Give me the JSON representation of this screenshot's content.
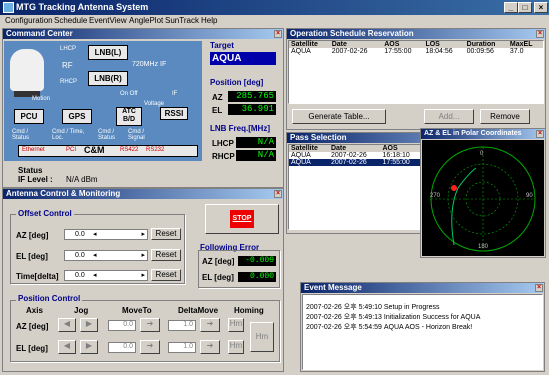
{
  "window": {
    "title": "MTG Tracking Antenna System",
    "min": "_",
    "max": "□",
    "close": "×"
  },
  "menu": [
    "Configuration",
    "Schedule",
    "EventView",
    "AnglePlot",
    "SunTrack",
    "Help"
  ],
  "command_center": {
    "title": "Command Center",
    "diagram": {
      "lhcp": "LHCP",
      "rhcp": "RHCP",
      "rf": "RF",
      "lnb_l": "LNB(L)",
      "lnb_r": "LNB(R)",
      "freq": "720MHz IF",
      "motion": "Motion",
      "pcu": "PCU",
      "gps": "GPS",
      "atc": "ATC B/D",
      "rssi": "RSSI",
      "onoff": "On Off",
      "voltage": "Voltage",
      "if": "IF",
      "cmd_status1": "Cmd / Status",
      "cmd_time": "Cmd / Time, Loc.",
      "cmd_status2": "Cmd / Status",
      "cmd_signal": "Cmd / Signal",
      "ethernet": "Ethernet",
      "pci": "PCI",
      "cm": "C&M",
      "rs422": "RS422",
      "rs232": "RS232"
    },
    "target_label": "Target",
    "target": "AQUA",
    "position_label": "Position [deg]",
    "az_label": "AZ",
    "az": "285.765",
    "el_label": "EL",
    "el": "36.991",
    "lnb_label": "LNB Freq.[MHz]",
    "lhcp_label": "LHCP",
    "lhcp": "N/A",
    "rhcp_label": "RHCP",
    "rhcp": "N/A",
    "status_label": "Status",
    "if_level_label": "IF Level :",
    "if_level": "N/A dBm"
  },
  "antenna": {
    "title": "Antenna Control & Monitoring",
    "offset_label": "Offset Control",
    "rows": [
      {
        "label": "AZ [deg]",
        "value": "0.0",
        "reset": "Reset"
      },
      {
        "label": "EL [deg]",
        "value": "0.0",
        "reset": "Reset"
      },
      {
        "label": "Time[delta]",
        "value": "0.0",
        "reset": "Reset"
      }
    ],
    "stop": "STOP",
    "following_label": "Following Error",
    "fe_az_label": "AZ [deg]",
    "fe_az": "-0.009",
    "fe_el_label": "EL [deg]",
    "fe_el": "0.000",
    "position_label": "Position Control",
    "cols": {
      "axis": "Axis",
      "jog": "Jog",
      "moveto": "MoveTo",
      "deltamove": "DeltaMove",
      "homing": "Homing"
    },
    "az_label": "AZ [deg]",
    "el_label": "EL [deg]",
    "pc_az_move": "0.0",
    "pc_az_delta": "1.0",
    "pc_el_move": "0.0",
    "pc_el_delta": "1.0",
    "hm": "Hm"
  },
  "schedule": {
    "title": "Operation Schedule Reservation",
    "cols": [
      "Satellite",
      "Date",
      "AOS",
      "LOS",
      "Duration",
      "MaxEL"
    ],
    "rows": [
      [
        "AQUA",
        "2007-02-26",
        "17:55:00",
        "18:04:56",
        "00:09:56",
        "37.0"
      ]
    ],
    "generate": "Generate Table...",
    "add": "Add...",
    "remove": "Remove"
  },
  "pass": {
    "title": "Pass Selection",
    "cols": [
      "Satellite",
      "Date",
      "AOS"
    ],
    "rows": [
      [
        "AQUA",
        "2007-02-26",
        "16:18:10"
      ],
      [
        "AQUA",
        "2007-02-26",
        "17:55:00"
      ]
    ]
  },
  "polar": {
    "title": "AZ & EL in Polar Coordinates",
    "n": "0",
    "e": "90",
    "s": "180",
    "w": "270"
  },
  "events": {
    "title": "Event Message",
    "lines": [
      "2007-02-26 오후 5:49:10  Setup in Progress",
      "2007-02-26 오후 5:49:13  Initialization Success for AQUA",
      "2007-02-26 오후 5:54:59  AQUA AOS - Horizon Break!"
    ]
  }
}
